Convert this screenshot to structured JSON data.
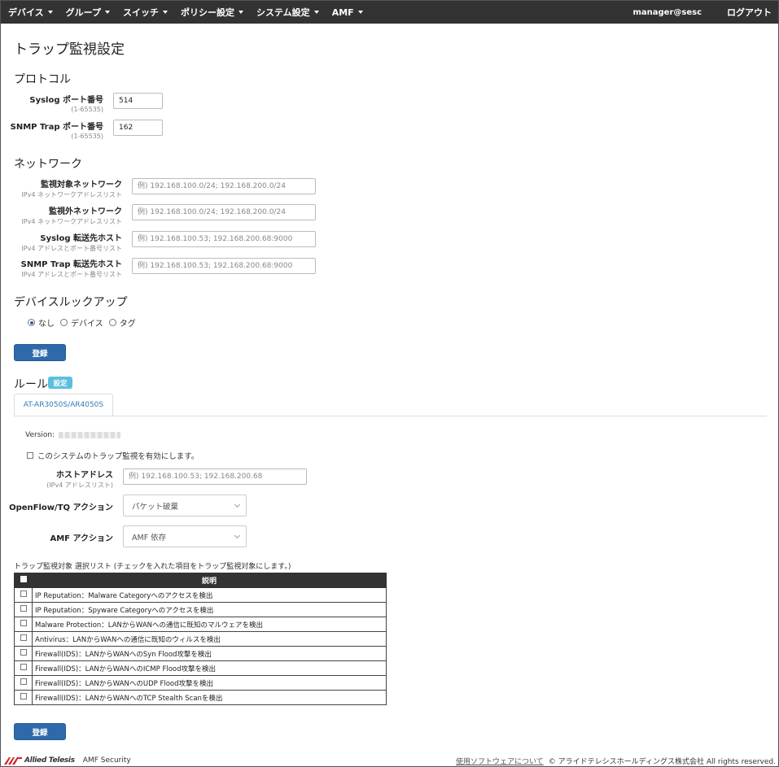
{
  "nav": {
    "items": [
      "デバイス",
      "グループ",
      "スイッチ",
      "ポリシー設定",
      "システム設定",
      "AMF"
    ],
    "user": "manager@sesc",
    "logout": "ログアウト"
  },
  "page": {
    "title": "トラップ監視設定"
  },
  "protocol": {
    "title": "プロトコル",
    "syslog_label": "Syslog ポート番号",
    "syslog_hint": "(1-65535)",
    "syslog_value": "514",
    "snmp_label": "SNMP Trap ポート番号",
    "snmp_hint": "(1-65535)",
    "snmp_value": "162"
  },
  "network": {
    "title": "ネットワーク",
    "fields": [
      {
        "label": "監視対象ネットワーク",
        "hint": "IPv4 ネットワークアドレスリスト",
        "placeholder": "例) 192.168.100.0/24; 192.168.200.0/24"
      },
      {
        "label": "監視外ネットワーク",
        "hint": "IPv4 ネットワークアドレスリスト",
        "placeholder": "例) 192.168.100.0/24; 192.168.200.0/24"
      },
      {
        "label": "Syslog 転送先ホスト",
        "hint": "IPv4 アドレスとポート番号リスト",
        "placeholder": "例) 192.168.100.53; 192.168.200.68:9000"
      },
      {
        "label": "SNMP Trap 転送先ホスト",
        "hint": "IPv4 アドレスとポート番号リスト",
        "placeholder": "例) 192.168.100.53; 192.168.200.68:9000"
      }
    ]
  },
  "lookup": {
    "title": "デバイスルックアップ",
    "options": [
      "なし",
      "デバイス",
      "タグ"
    ],
    "selected": 0
  },
  "buttons": {
    "register": "登録"
  },
  "rules": {
    "title": "ルール",
    "badge": "設定",
    "tab": "AT-AR3050S/AR4050S",
    "version_label": "Version:",
    "enable_label": "このシステムのトラップ監視を有効にします。",
    "host_label": "ホストアドレス",
    "host_hint": "(IPv4 アドレスリスト)",
    "host_placeholder": "例) 192.168.100.53; 192.168.200.68",
    "openflow_label": "OpenFlow/TQ アクション",
    "openflow_value": "パケット破棄",
    "amf_label": "AMF アクション",
    "amf_value": "AMF 依存",
    "list_caption": "トラップ監視対象 選択リスト (チェックを入れた項目をトラップ監視対象にします。)",
    "table_header": "説明",
    "table_rows": [
      "IP Reputation：Malware Categoryへのアクセスを検出",
      "IP Reputation：Spyware Categoryへのアクセスを検出",
      "Malware Protection：LANからWANへの通信に既知のマルウェアを検出",
      "Antivirus：LANからWANへの通信に既知のウィルスを検出",
      "Firewall(IDS)：LANからWANへのSyn Flood攻撃を検出",
      "Firewall(IDS)：LANからWANへのICMP Flood攻撃を検出",
      "Firewall(IDS)：LANからWANへのUDP Flood攻撃を検出",
      "Firewall(IDS)：LANからWANへのTCP Stealth Scanを検出"
    ]
  },
  "footer": {
    "logo": "Allied Telesis",
    "product": "AMF Security",
    "link": "使用ソフトウェアについて",
    "copyright": "© アライドテレシスホールディングス株式会社 All rights reserved."
  },
  "colors": {
    "navbar": "#333333",
    "primary": "#2e69ac",
    "badge": "#5bc0de",
    "tab_text": "#337ab7",
    "logo_red": "#d2232a"
  }
}
